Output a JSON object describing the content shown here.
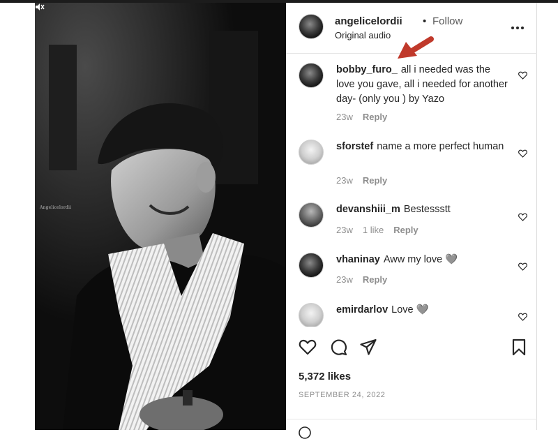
{
  "media": {
    "credit_text": "Angelicelordii"
  },
  "header": {
    "username": "angelicelordii",
    "separator": "•",
    "follow_label": "Follow",
    "audio_label": "Original audio"
  },
  "comments": [
    {
      "user": "bobby_furo_",
      "text": "all i needed was the love you gave, all i needed for another day- (only you ) by Yazo",
      "time": "23w",
      "likes": "",
      "reply": "Reply"
    },
    {
      "user": "sforstef",
      "text": "name a more perfect human",
      "time": "23w",
      "likes": "",
      "reply": "Reply"
    },
    {
      "user": "devanshiii_m",
      "text": "Bestessstt",
      "time": "23w",
      "likes": "1 like",
      "reply": "Reply"
    },
    {
      "user": "vhaninay",
      "text": "Aww my love 🩶",
      "time": "23w",
      "likes": "",
      "reply": "Reply"
    },
    {
      "user": "emirdarlov",
      "text": "Love 🩶",
      "time": "",
      "likes": "",
      "reply": ""
    }
  ],
  "footer": {
    "likes": "5,372 likes",
    "date": "SEPTEMBER 24, 2022"
  },
  "icons": {
    "header_more": "more-options-icon",
    "like": "heart-icon",
    "comment": "comment-icon",
    "share": "share-icon",
    "save": "bookmark-icon",
    "mute": "muted-speaker-icon",
    "annotation": "red-arrow-annotation"
  },
  "colors": {
    "annotation_arrow": "#c0392b",
    "muted_text": "#8e8e8e",
    "text": "#262626"
  }
}
